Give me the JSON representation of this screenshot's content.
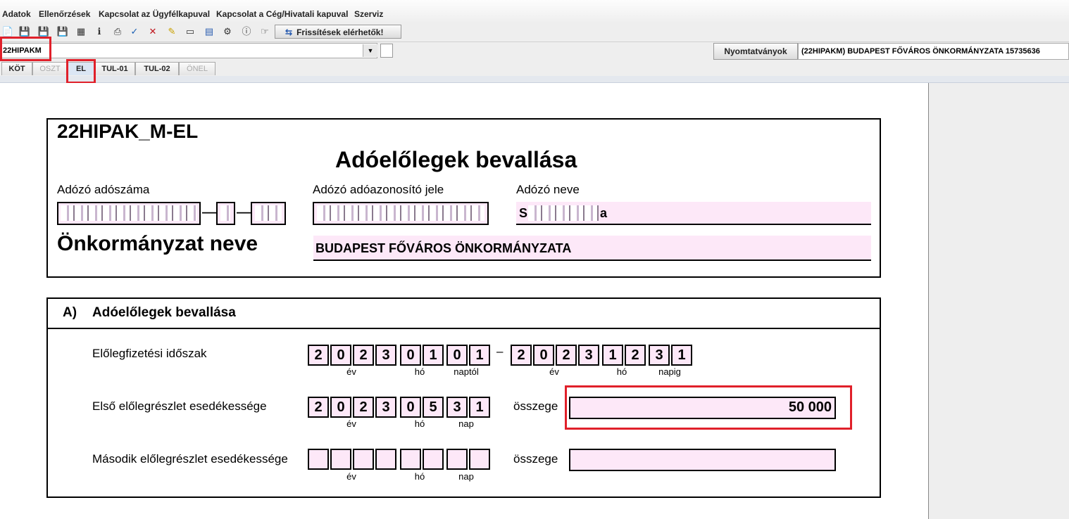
{
  "menu": [
    "Adatok",
    "Ellenőrzések",
    "Kapcsolat az Ügyfélkapuval",
    "Kapcsolat a Cég/Hivatali kapuval",
    "Szerviz"
  ],
  "toolbar": {
    "icons": [
      "open-icon",
      "save-icon",
      "save-close-icon",
      "save-as-icon",
      "calculator-icon",
      "info-icon",
      "print-icon",
      "check-icon",
      "delete-icon",
      "edit-icon",
      "monitor-icon",
      "book-icon",
      "settings-icon",
      "about-icon",
      "hand-icon"
    ],
    "update_label": "Frissítések elérhetők!"
  },
  "combo": {
    "value": "22HIPAKM"
  },
  "nyomtatvanyok_label": "Nyomtatványok",
  "form_title_field": "(22HIPAKM) BUDAPEST FŐVÁROS ÖNKORMÁNYZATA 15735636",
  "tabs": [
    {
      "label": "KÖT",
      "state": "normal"
    },
    {
      "label": "OSZT",
      "state": "disabled"
    },
    {
      "label": "EL",
      "state": "active"
    },
    {
      "label": "TUL-01",
      "state": "normal"
    },
    {
      "label": "TUL-02",
      "state": "normal"
    },
    {
      "label": "ÖNEL",
      "state": "disabled"
    }
  ],
  "form": {
    "code": "22HIPAK_M-EL",
    "title": "Adóelőlegek bevallása",
    "adoszam_label": "Adózó adószáma",
    "adoazonosito_label": "Adózó adóazonosító jele",
    "nev_label": "Adózó neve",
    "nev_value": "S",
    "nev_value_tail": "a",
    "onkormanyzat_label": "Önkormányzat neve",
    "onkormanyzat_value": "BUDAPEST FŐVÁROS ÖNKORMÁNYZATA"
  },
  "section_a": {
    "letter": "A)",
    "title": "Adóelőlegek bevallása",
    "period_label": "Előlegfizetési időszak",
    "period_from": [
      "2",
      "0",
      "2",
      "3",
      "0",
      "1",
      "0",
      "1"
    ],
    "period_to": [
      "2",
      "0",
      "2",
      "3",
      "1",
      "2",
      "3",
      "1"
    ],
    "period_dash": "–",
    "cap_ev": "év",
    "cap_ho": "hó",
    "cap_naptol": "naptól",
    "cap_napig": "napig",
    "cap_nap": "nap",
    "first_label": "Első előlegrészlet esedékessége",
    "first_date": [
      "2",
      "0",
      "2",
      "3",
      "0",
      "5",
      "3",
      "1"
    ],
    "osszege_label": "összege",
    "first_amount": "50 000",
    "second_label": "Második előlegrészlet esedékessége",
    "second_date": [
      "",
      "",
      "",
      "",
      "",
      "",
      "",
      ""
    ],
    "second_amount": ""
  },
  "colors": {
    "highlight_red": "#e0202a",
    "field_pink": "#fde8f8"
  }
}
